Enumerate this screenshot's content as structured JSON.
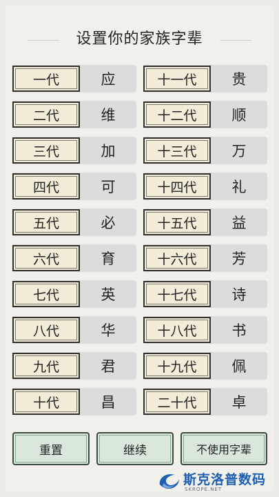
{
  "title": "设置你的家族字辈",
  "generations": [
    {
      "label": "一代",
      "name": "应"
    },
    {
      "label": "十一代",
      "name": "贵"
    },
    {
      "label": "二代",
      "name": "维"
    },
    {
      "label": "十二代",
      "name": "顺"
    },
    {
      "label": "三代",
      "name": "加"
    },
    {
      "label": "十三代",
      "name": "万"
    },
    {
      "label": "四代",
      "name": "可"
    },
    {
      "label": "十四代",
      "name": "礼"
    },
    {
      "label": "五代",
      "name": "必"
    },
    {
      "label": "十五代",
      "name": "益"
    },
    {
      "label": "六代",
      "name": "育"
    },
    {
      "label": "十六代",
      "name": "芳"
    },
    {
      "label": "七代",
      "name": "英"
    },
    {
      "label": "十七代",
      "name": "诗"
    },
    {
      "label": "八代",
      "name": "华"
    },
    {
      "label": "十八代",
      "name": "书"
    },
    {
      "label": "九代",
      "name": "君"
    },
    {
      "label": "十九代",
      "name": "佩"
    },
    {
      "label": "十代",
      "name": "昌"
    },
    {
      "label": "二十代",
      "name": "卓"
    }
  ],
  "buttons": {
    "reset": "重置",
    "continue": "继续",
    "skip": "不使用字辈"
  },
  "watermark": {
    "text": "斯克洛普数码",
    "sub": "SKROPE.NET",
    "icon": "swirl-logo-icon"
  },
  "colors": {
    "tag_bg": "#f3ecd9",
    "row_bg": "#dcdcdc",
    "button_bg": "#d9e8da",
    "watermark_blue": "#1d5fb0"
  }
}
